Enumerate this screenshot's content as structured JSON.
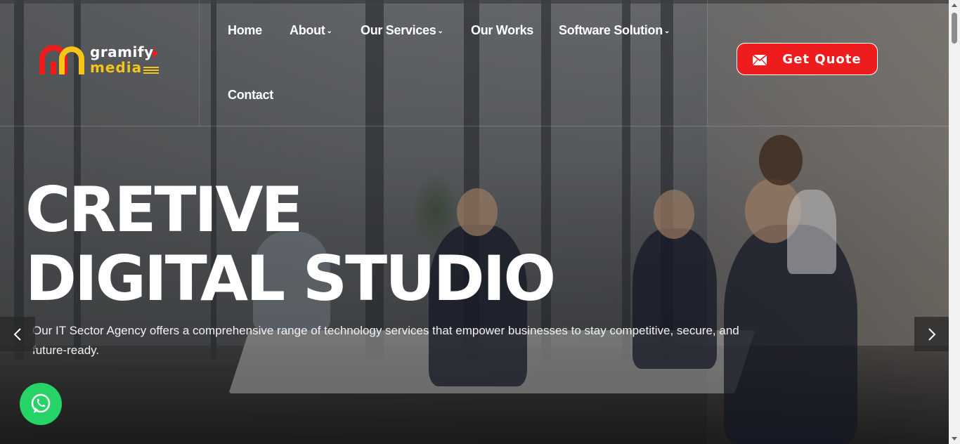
{
  "brand": {
    "name_line1": "gramify",
    "name_line2": "media",
    "colors": {
      "red": "#ee1c1c",
      "yellow": "#f7c41a"
    }
  },
  "nav": {
    "items": [
      {
        "label": "Home",
        "has_dropdown": false
      },
      {
        "label": "About",
        "has_dropdown": true
      },
      {
        "label": "Our Services",
        "has_dropdown": true
      },
      {
        "label": "Our Works",
        "has_dropdown": false
      },
      {
        "label": "Software Solution",
        "has_dropdown": true
      },
      {
        "label": "Contact",
        "has_dropdown": false
      }
    ],
    "dropdown_glyph": "⌄"
  },
  "cta": {
    "label": "Get Quote",
    "icon": "mail-icon",
    "color": "#ee1c1c"
  },
  "hero": {
    "title_line1": "CRETIVE",
    "title_line2": "DIGITAL STUDIO",
    "description": "Our IT Sector Agency offers a comprehensive range of technology services that empower businesses to stay competitive, secure, and future-ready."
  },
  "slider": {
    "prev_icon": "chevron-left-icon",
    "next_icon": "chevron-right-icon"
  },
  "floating": {
    "whatsapp_icon": "whatsapp-icon",
    "color": "#25d366"
  }
}
